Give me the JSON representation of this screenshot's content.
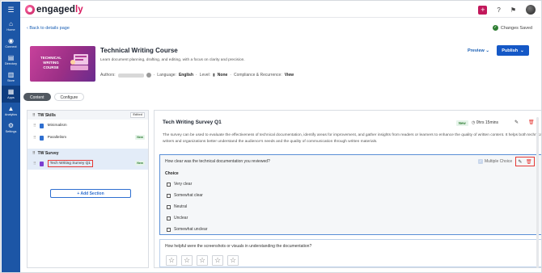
{
  "rail": {
    "items": [
      {
        "label": "Home",
        "icon": "home-icon"
      },
      {
        "label": "Connect",
        "icon": "connect-icon"
      },
      {
        "label": "Directory",
        "icon": "directory-icon"
      },
      {
        "label": "Store",
        "icon": "store-icon"
      },
      {
        "label": "Apps",
        "icon": "apps-icon"
      },
      {
        "label": "Analytics",
        "icon": "analytics-icon"
      },
      {
        "label": "Settings",
        "icon": "settings-icon"
      }
    ]
  },
  "logo": {
    "pre": "engaged",
    "accent": "ly"
  },
  "header": {
    "back": "Back to details page",
    "saved": "Changes Saved"
  },
  "course": {
    "thumb_text": "TECHNICAL WRITING COURSE",
    "title": "Technical Writing Course",
    "description": "Learn document planning, drafting, and editing, with a focus on clarity and precision.",
    "authors_label": "Authors:",
    "language_label": "Language:",
    "language": "English",
    "level_label": "Level:",
    "level": "None",
    "compliance_label": "Compliance & Recurrence:",
    "view": "View",
    "preview": "Preview",
    "publish": "Publish"
  },
  "tabs": [
    "Content",
    "Configure"
  ],
  "sections": [
    {
      "title": "TW Skills",
      "status": "Edited",
      "items": [
        {
          "label": "Minimalism",
          "new": ""
        },
        {
          "label": "Parallelism",
          "new": "New"
        }
      ]
    },
    {
      "title": "TW Survey",
      "status": "",
      "items": [
        {
          "label": "Tech Writing Survey Q1",
          "new": "New"
        }
      ]
    }
  ],
  "add_section": "+ Add Section",
  "survey": {
    "title": "Tech Writing Survey Q1",
    "badge": "New",
    "duration": "0hrs 15mins",
    "description": "The survey can be used to evaluate the effectiveness of technical documentation, identify areas for improvement, and gather insights from readers or learners to enhance the quality of written content. It helps both technical writers and organizations better understand the audience's needs and the quality of communication through written materials.",
    "q1": {
      "text": "How clear was the technical documentation you reviewed?",
      "type": "Multiple Choice",
      "choice_label": "Choice",
      "options": [
        "Very clear",
        "Somewhat clear",
        "Neutral",
        "Unclear",
        "Somewhat unclear"
      ]
    },
    "q2": {
      "text": "How helpful were the screenshots or visuals in understanding the documentation?",
      "stars": 5
    }
  },
  "colors": {
    "rail": "#1c56a6",
    "primary": "#1558c6",
    "highlight": "#e53935"
  }
}
